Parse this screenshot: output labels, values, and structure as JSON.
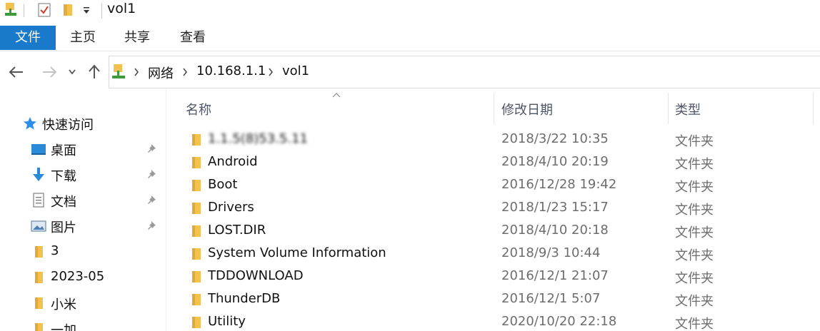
{
  "window": {
    "title": "vol1"
  },
  "ribbon": {
    "tabs": [
      {
        "label": "文件",
        "active": true
      },
      {
        "label": "主页"
      },
      {
        "label": "共享"
      },
      {
        "label": "查看"
      }
    ]
  },
  "address": {
    "breadcrumbs": [
      "网络",
      "10.168.1.1",
      "vol1"
    ]
  },
  "sidebar": {
    "quick_access": "快速访问",
    "items": [
      {
        "label": "桌面",
        "icon": "desktop-icon",
        "pinned": true
      },
      {
        "label": "下载",
        "icon": "download-icon",
        "pinned": true
      },
      {
        "label": "文档",
        "icon": "document-icon",
        "pinned": true
      },
      {
        "label": "图片",
        "icon": "picture-icon",
        "pinned": true
      },
      {
        "label": "3",
        "icon": "folder-icon",
        "pinned": false
      },
      {
        "label": "2023-05",
        "icon": "folder-icon",
        "pinned": false
      },
      {
        "label": "小米",
        "icon": "folder-icon",
        "pinned": false
      },
      {
        "label": "一加",
        "icon": "folder-icon",
        "pinned": false
      }
    ]
  },
  "list": {
    "columns": {
      "name": "名称",
      "date": "修改日期",
      "type": "类型"
    },
    "rows": [
      {
        "name": "1.1.5(8)53.5.11",
        "date": "2018/3/22 10:35",
        "type": "文件夹",
        "name_blurred": true
      },
      {
        "name": "Android",
        "date": "2018/4/10 20:19",
        "type": "文件夹"
      },
      {
        "name": "Boot",
        "date": "2016/12/28 19:42",
        "type": "文件夹"
      },
      {
        "name": "Drivers",
        "date": "2018/1/23 15:17",
        "type": "文件夹"
      },
      {
        "name": "LOST.DIR",
        "date": "2018/4/10 20:18",
        "type": "文件夹"
      },
      {
        "name": "System Volume Information",
        "date": "2018/9/3 10:44",
        "type": "文件夹"
      },
      {
        "name": "TDDOWNLOAD",
        "date": "2016/12/1 21:07",
        "type": "文件夹"
      },
      {
        "name": "ThunderDB",
        "date": "2016/12/1 5:07",
        "type": "文件夹"
      },
      {
        "name": "Utility",
        "date": "2020/10/20 22:18",
        "type": "文件夹"
      }
    ]
  },
  "colors": {
    "accent": "#1979ca",
    "folder": "#f2c14e",
    "folder_dark": "#d9a43a"
  }
}
